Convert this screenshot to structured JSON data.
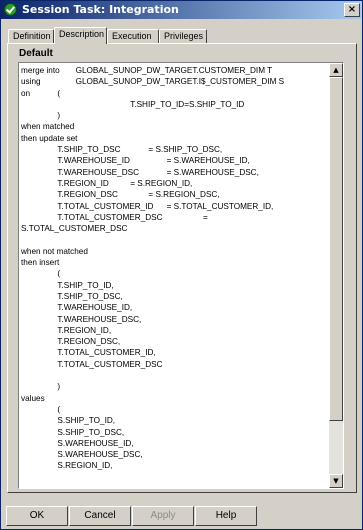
{
  "window": {
    "title": "Session Task: Integration",
    "close_glyph": "×"
  },
  "tabs": [
    {
      "label": "Definition"
    },
    {
      "label": "Description",
      "active": true
    },
    {
      "label": "Execution"
    },
    {
      "label": "Privileges"
    }
  ],
  "section": {
    "label": "Default"
  },
  "editor": {
    "text": "merge into\tGLOBAL_SUNOP_DW_TARGET.CUSTOMER_DIM T\nusing\t\tGLOBAL_SUNOP_DW_TARGET.I$_CUSTOMER_DIM S\non\t\t(\n\t\t\t\t\t\tT.SHIP_TO_ID=S.SHIP_TO_ID\n\t\t)\nwhen matched\nthen update set\n\t\tT.SHIP_TO_DSC\t\t= S.SHIP_TO_DSC,\n\t\tT.WAREHOUSE_ID\t\t= S.WAREHOUSE_ID,\n\t\tT.WAREHOUSE_DSC\t\t= S.WAREHOUSE_DSC,\n\t\tT.REGION_ID\t\t= S.REGION_ID,\n\t\tT.REGION_DSC\t\t= S.REGION_DSC,\n\t\tT.TOTAL_CUSTOMER_ID\t= S.TOTAL_CUSTOMER_ID,\n\t\tT.TOTAL_CUSTOMER_DSC\t\t\t=\nS.TOTAL_CUSTOMER_DSC\n\nwhen not matched\nthen insert\n\t\t(\n\t\tT.SHIP_TO_ID,\n\t\tT.SHIP_TO_DSC,\n\t\tT.WAREHOUSE_ID,\n\t\tT.WAREHOUSE_DSC,\n\t\tT.REGION_ID,\n\t\tT.REGION_DSC,\n\t\tT.TOTAL_CUSTOMER_ID,\n\t\tT.TOTAL_CUSTOMER_DSC\n\n\t\t)\nvalues\n\t\t(\n\t\tS.SHIP_TO_ID,\n\t\tS.SHIP_TO_DSC,\n\t\tS.WAREHOUSE_ID,\n\t\tS.WAREHOUSE_DSC,\n\t\tS.REGION_ID,",
    "scroll_position": 0
  },
  "buttons": {
    "ok": "OK",
    "cancel": "Cancel",
    "apply": "Apply",
    "help": "Help"
  },
  "icons": {
    "app": "green-check-icon",
    "scroll_up": "▲",
    "scroll_down": "▼"
  }
}
